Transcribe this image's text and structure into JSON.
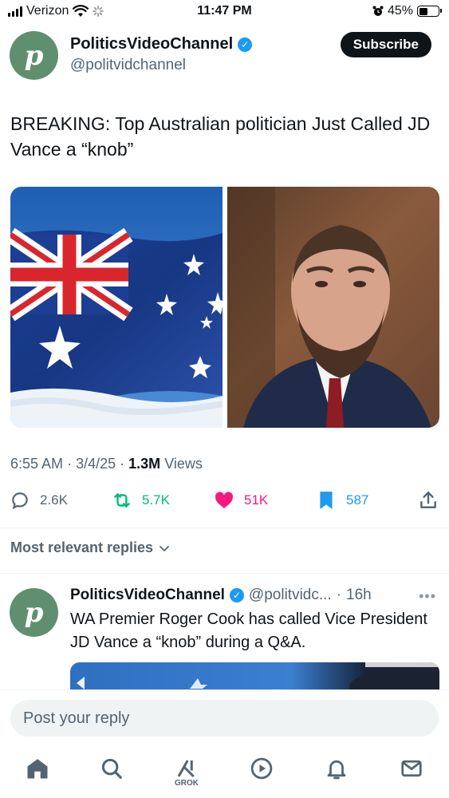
{
  "status_bar": {
    "carrier": "Verizon",
    "time": "11:47 PM",
    "battery_percent": "45%",
    "battery_level": 0.45
  },
  "post": {
    "author": {
      "display_name": "PoliticsVideoChannel",
      "handle": "@politvidchannel",
      "avatar_letter": "p",
      "verified_icon": "verified-badge-icon"
    },
    "subscribe_label": "Subscribe",
    "text": "BREAKING: Top Australian politician Just Called JD Vance a “knob”",
    "time": "6:55 AM",
    "date": "3/4/25",
    "views_count": "1.3M",
    "views_label": "Views",
    "separator": "·",
    "stats": {
      "replies": "2.6K",
      "reposts": "5.7K",
      "likes": "51K",
      "bookmarks": "587"
    }
  },
  "replies_sort_label": "Most relevant replies",
  "reply": {
    "display_name": "PoliticsVideoChannel",
    "handle": "@politvidc...",
    "age": "16h",
    "avatar_letter": "p",
    "text": "WA Premier Roger Cook has called Vice President JD Vance a “knob” during a Q&A."
  },
  "compose": {
    "placeholder": "Post your reply"
  },
  "tab_bar": {
    "grok_label": "GROK"
  },
  "colors": {
    "verified_blue": "#1d9bf0",
    "repost_green": "#00ba7c",
    "like_pink": "#f91880",
    "bookmark_blue": "#1d9bf0",
    "text_primary": "#0f1419",
    "text_secondary": "#536471"
  }
}
